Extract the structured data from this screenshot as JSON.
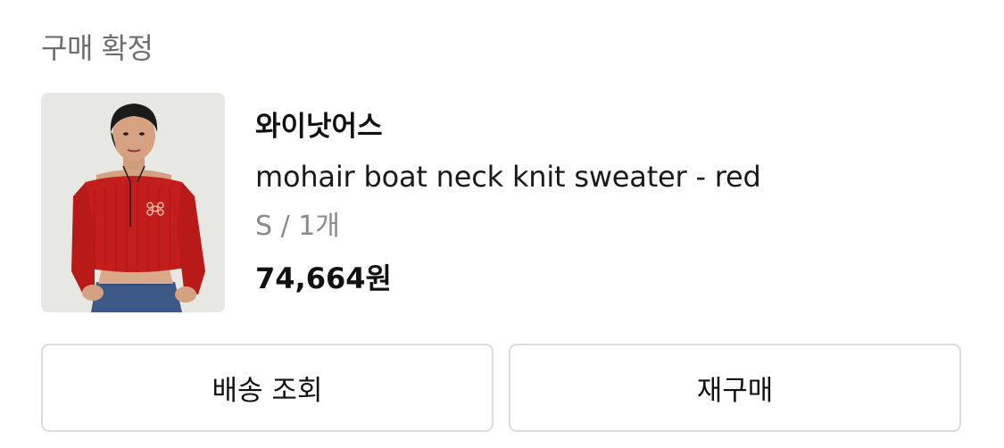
{
  "order": {
    "status_label": "구매 확정"
  },
  "product": {
    "brand": "와이낫어스",
    "name": "mohair boat neck knit sweater - red",
    "option": "S / 1개",
    "price": "74,664원",
    "image_desc": "product-photo",
    "colors": {
      "sweater": "#c41e1c",
      "background": "#e6e6e3"
    }
  },
  "actions": {
    "track_shipping_label": "배송 조회",
    "rebuy_label": "재구매"
  },
  "colors": {
    "status_text": "#6e6e6e",
    "option_text": "#8a8a8a",
    "button_border": "#dcdcdc"
  }
}
